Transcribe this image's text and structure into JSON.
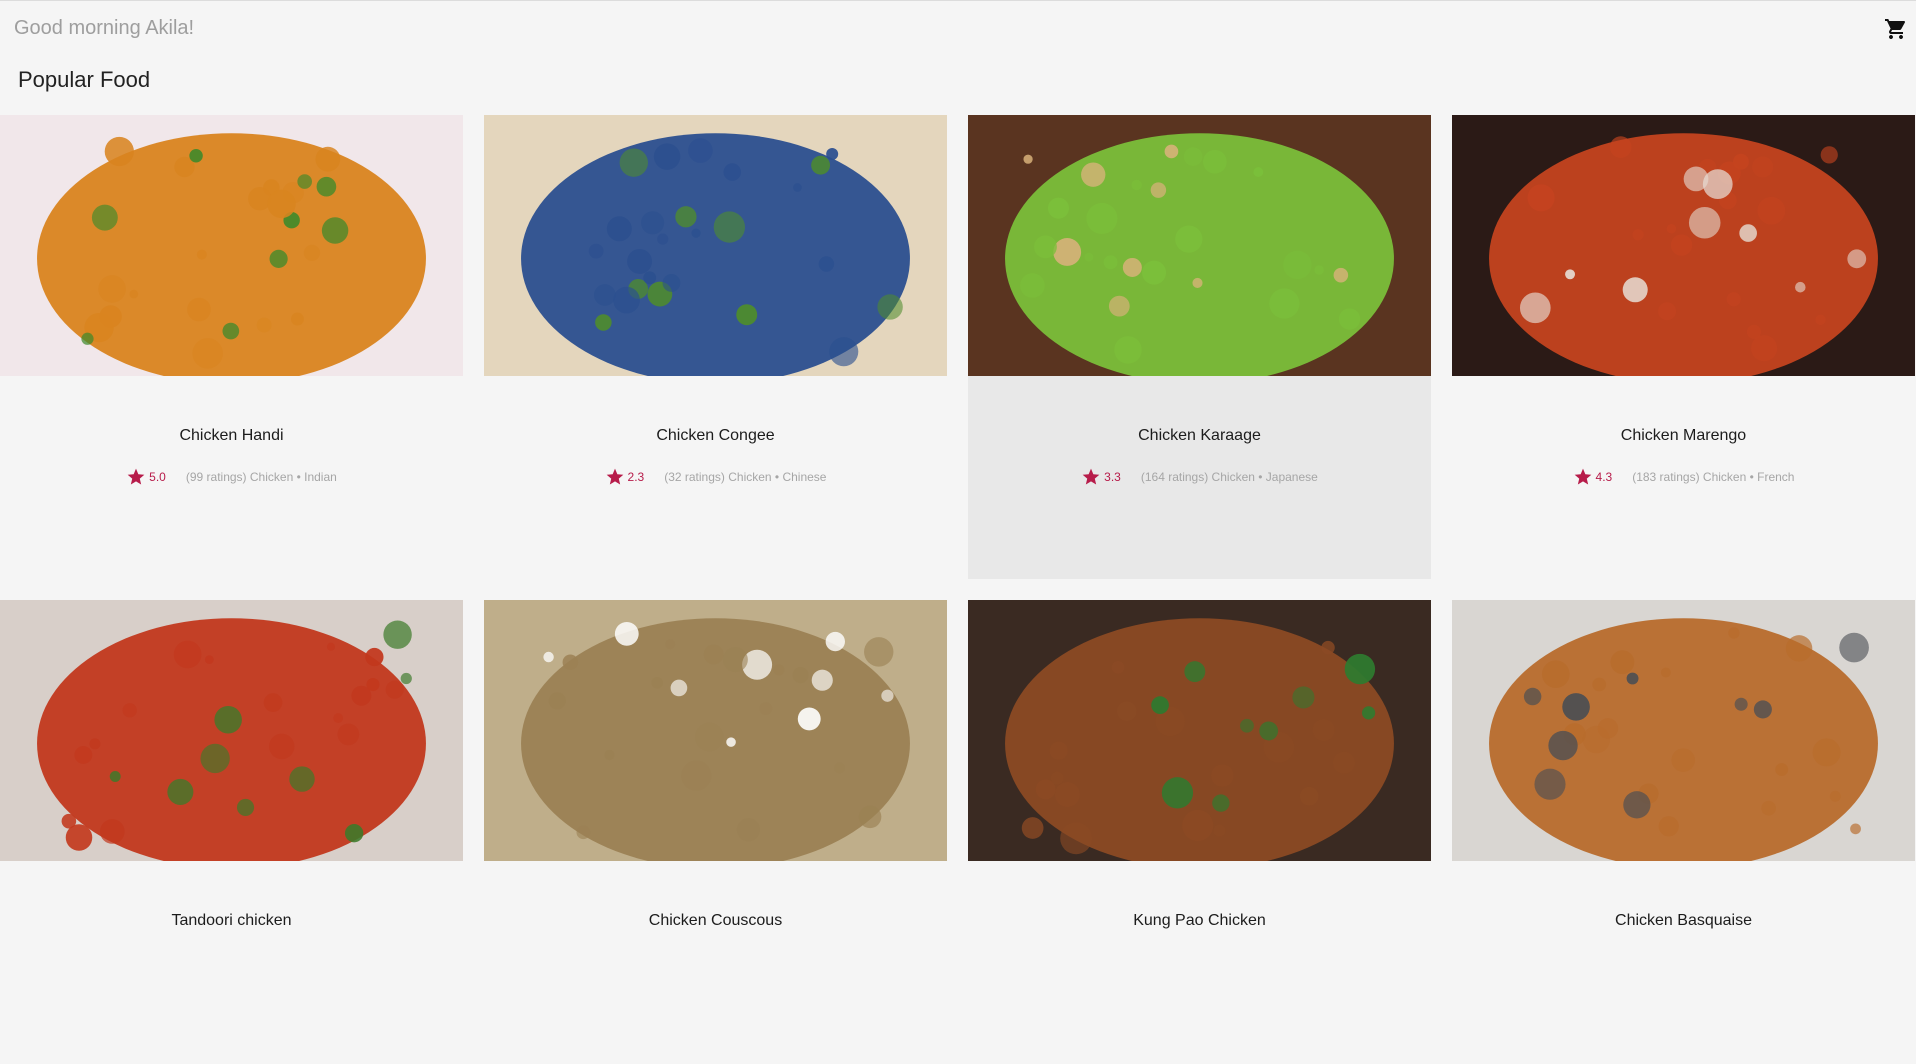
{
  "header": {
    "greeting": "Good morning Akila!",
    "cart_icon": "shopping-cart-icon"
  },
  "section": {
    "title": "Popular Food"
  },
  "colors": {
    "accent": "#b71c4a",
    "background": "#f5f5f5",
    "muted_text": "#a6a6a6"
  },
  "foods": [
    {
      "name": "Chicken Handi",
      "rating": "5.0",
      "details": "(99 ratings) Chicken • Indian",
      "palette": [
        "#f1e7ea",
        "#d9841f",
        "#3f8a2b"
      ]
    },
    {
      "name": "Chicken Congee",
      "rating": "2.3",
      "details": "(32 ratings) Chicken • Chinese",
      "palette": [
        "#e4d6bd",
        "#2b4f8f",
        "#4e8c2c"
      ]
    },
    {
      "name": "Chicken Karaage",
      "rating": "3.3",
      "details": "(164 ratings) Chicken • Japanese",
      "palette": [
        "#5a3420",
        "#7bbf3a",
        "#d9b27a"
      ]
    },
    {
      "name": "Chicken Marengo",
      "rating": "4.3",
      "details": "(183 ratings) Chicken • French",
      "palette": [
        "#2b1a16",
        "#c4431f",
        "#e6dcd3"
      ]
    },
    {
      "name": "Tandoori chicken",
      "rating": "",
      "details": "",
      "palette": [
        "#d8cfc9",
        "#c2381d",
        "#3c7a2a"
      ]
    },
    {
      "name": "Chicken Couscous",
      "rating": "",
      "details": "",
      "palette": [
        "#bfae8a",
        "#9b8154",
        "#ffffff"
      ]
    },
    {
      "name": "Kung Pao Chicken",
      "rating": "",
      "details": "",
      "palette": [
        "#3a2a22",
        "#8b4a24",
        "#2f7a2f"
      ]
    },
    {
      "name": "Chicken Basquaise",
      "rating": "",
      "details": "",
      "palette": [
        "#d9d6d2",
        "#b86c2c",
        "#4a4e54"
      ]
    }
  ]
}
